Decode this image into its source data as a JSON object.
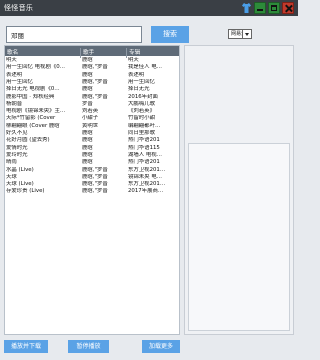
{
  "window": {
    "title": "怪怪音乐",
    "icons": [
      "shirt-icon",
      "minimize-icon",
      "maximize-icon",
      "close-icon"
    ],
    "colors": {
      "titlebar": "#3a3f45",
      "accent": "#5aa2e6",
      "header": "#5f6b78",
      "minimize": "#2d8a3a",
      "close": "#c0392b"
    }
  },
  "search": {
    "query": "邓丽",
    "button_label": "搜索",
    "source_selected": "网易云"
  },
  "table": {
    "columns": [
      "歌名",
      "歌手",
      "专辑"
    ],
    "rows": [
      {
        "name": "明天",
        "artist": "鹿晗",
        "album": "明天"
      },
      {
        "name": "用一生回忆 电视剧《0…",
        "artist": "鹿晗,\"罗晋",
        "album": "我是佳人 电…"
      },
      {
        "name": "表述明",
        "artist": "鹿晗",
        "album": "表述明"
      },
      {
        "name": "用一生回忆",
        "artist": "鹿晗,\"罗晋",
        "album": "用一生回忆"
      },
      {
        "name": "择日无光 电视剧《0…",
        "artist": "鹿晗",
        "album": "择日无光"
      },
      {
        "name": "鹿影中国 · 郑秋经典",
        "artist": "鹿晗,\"罗晋",
        "album": "2016年封面"
      },
      {
        "name": "杨朝晋",
        "artist": "罗晋",
        "album": "大鹏嗨儿歌"
      },
      {
        "name": "电视剧《镜锦未央》主…",
        "artist": "刘若英",
        "album": "《刘若英》"
      },
      {
        "name": "天际*竹留影 (Cover",
        "artist": "小甜子",
        "album": "竹留时小甜"
      },
      {
        "name": "柳翩翩眼 (Cover 鹿晗",
        "artist": "黄明世",
        "album": "编翩翩都叶…"
      },
      {
        "name": "好久不见",
        "artist": "鹿晗",
        "album": "同日里那歌"
      },
      {
        "name": "花好月圆 (望去秀)",
        "artist": "鹿晗",
        "album": "热门华语201"
      },
      {
        "name": "爱情时光",
        "artist": "鹿晗",
        "album": "热门华语115"
      },
      {
        "name": "爱玲时光",
        "artist": "鹿晗",
        "album": "湖墙人 电视…"
      },
      {
        "name": "晴雨",
        "artist": "鹿晗",
        "album": "热门华语201"
      },
      {
        "name": "水晶 (Live)",
        "artist": "鹿晗,\"罗晋",
        "album": "东方卫视201…"
      },
      {
        "name": "天球",
        "artist": "鹿晗,\"罗晋",
        "album": "镜锦未央 电…"
      },
      {
        "name": "天球 (Live)",
        "artist": "鹿晗,\"罗晋",
        "album": "东方卫视201…"
      },
      {
        "name": "存爱珍贵 (Live)",
        "artist": "鹿晗,\"罗晋",
        "album": "2017年展商…"
      }
    ]
  },
  "buttons": {
    "play_download": "播放并下载",
    "pause": "暂停播放",
    "load_more": "加载更多"
  }
}
